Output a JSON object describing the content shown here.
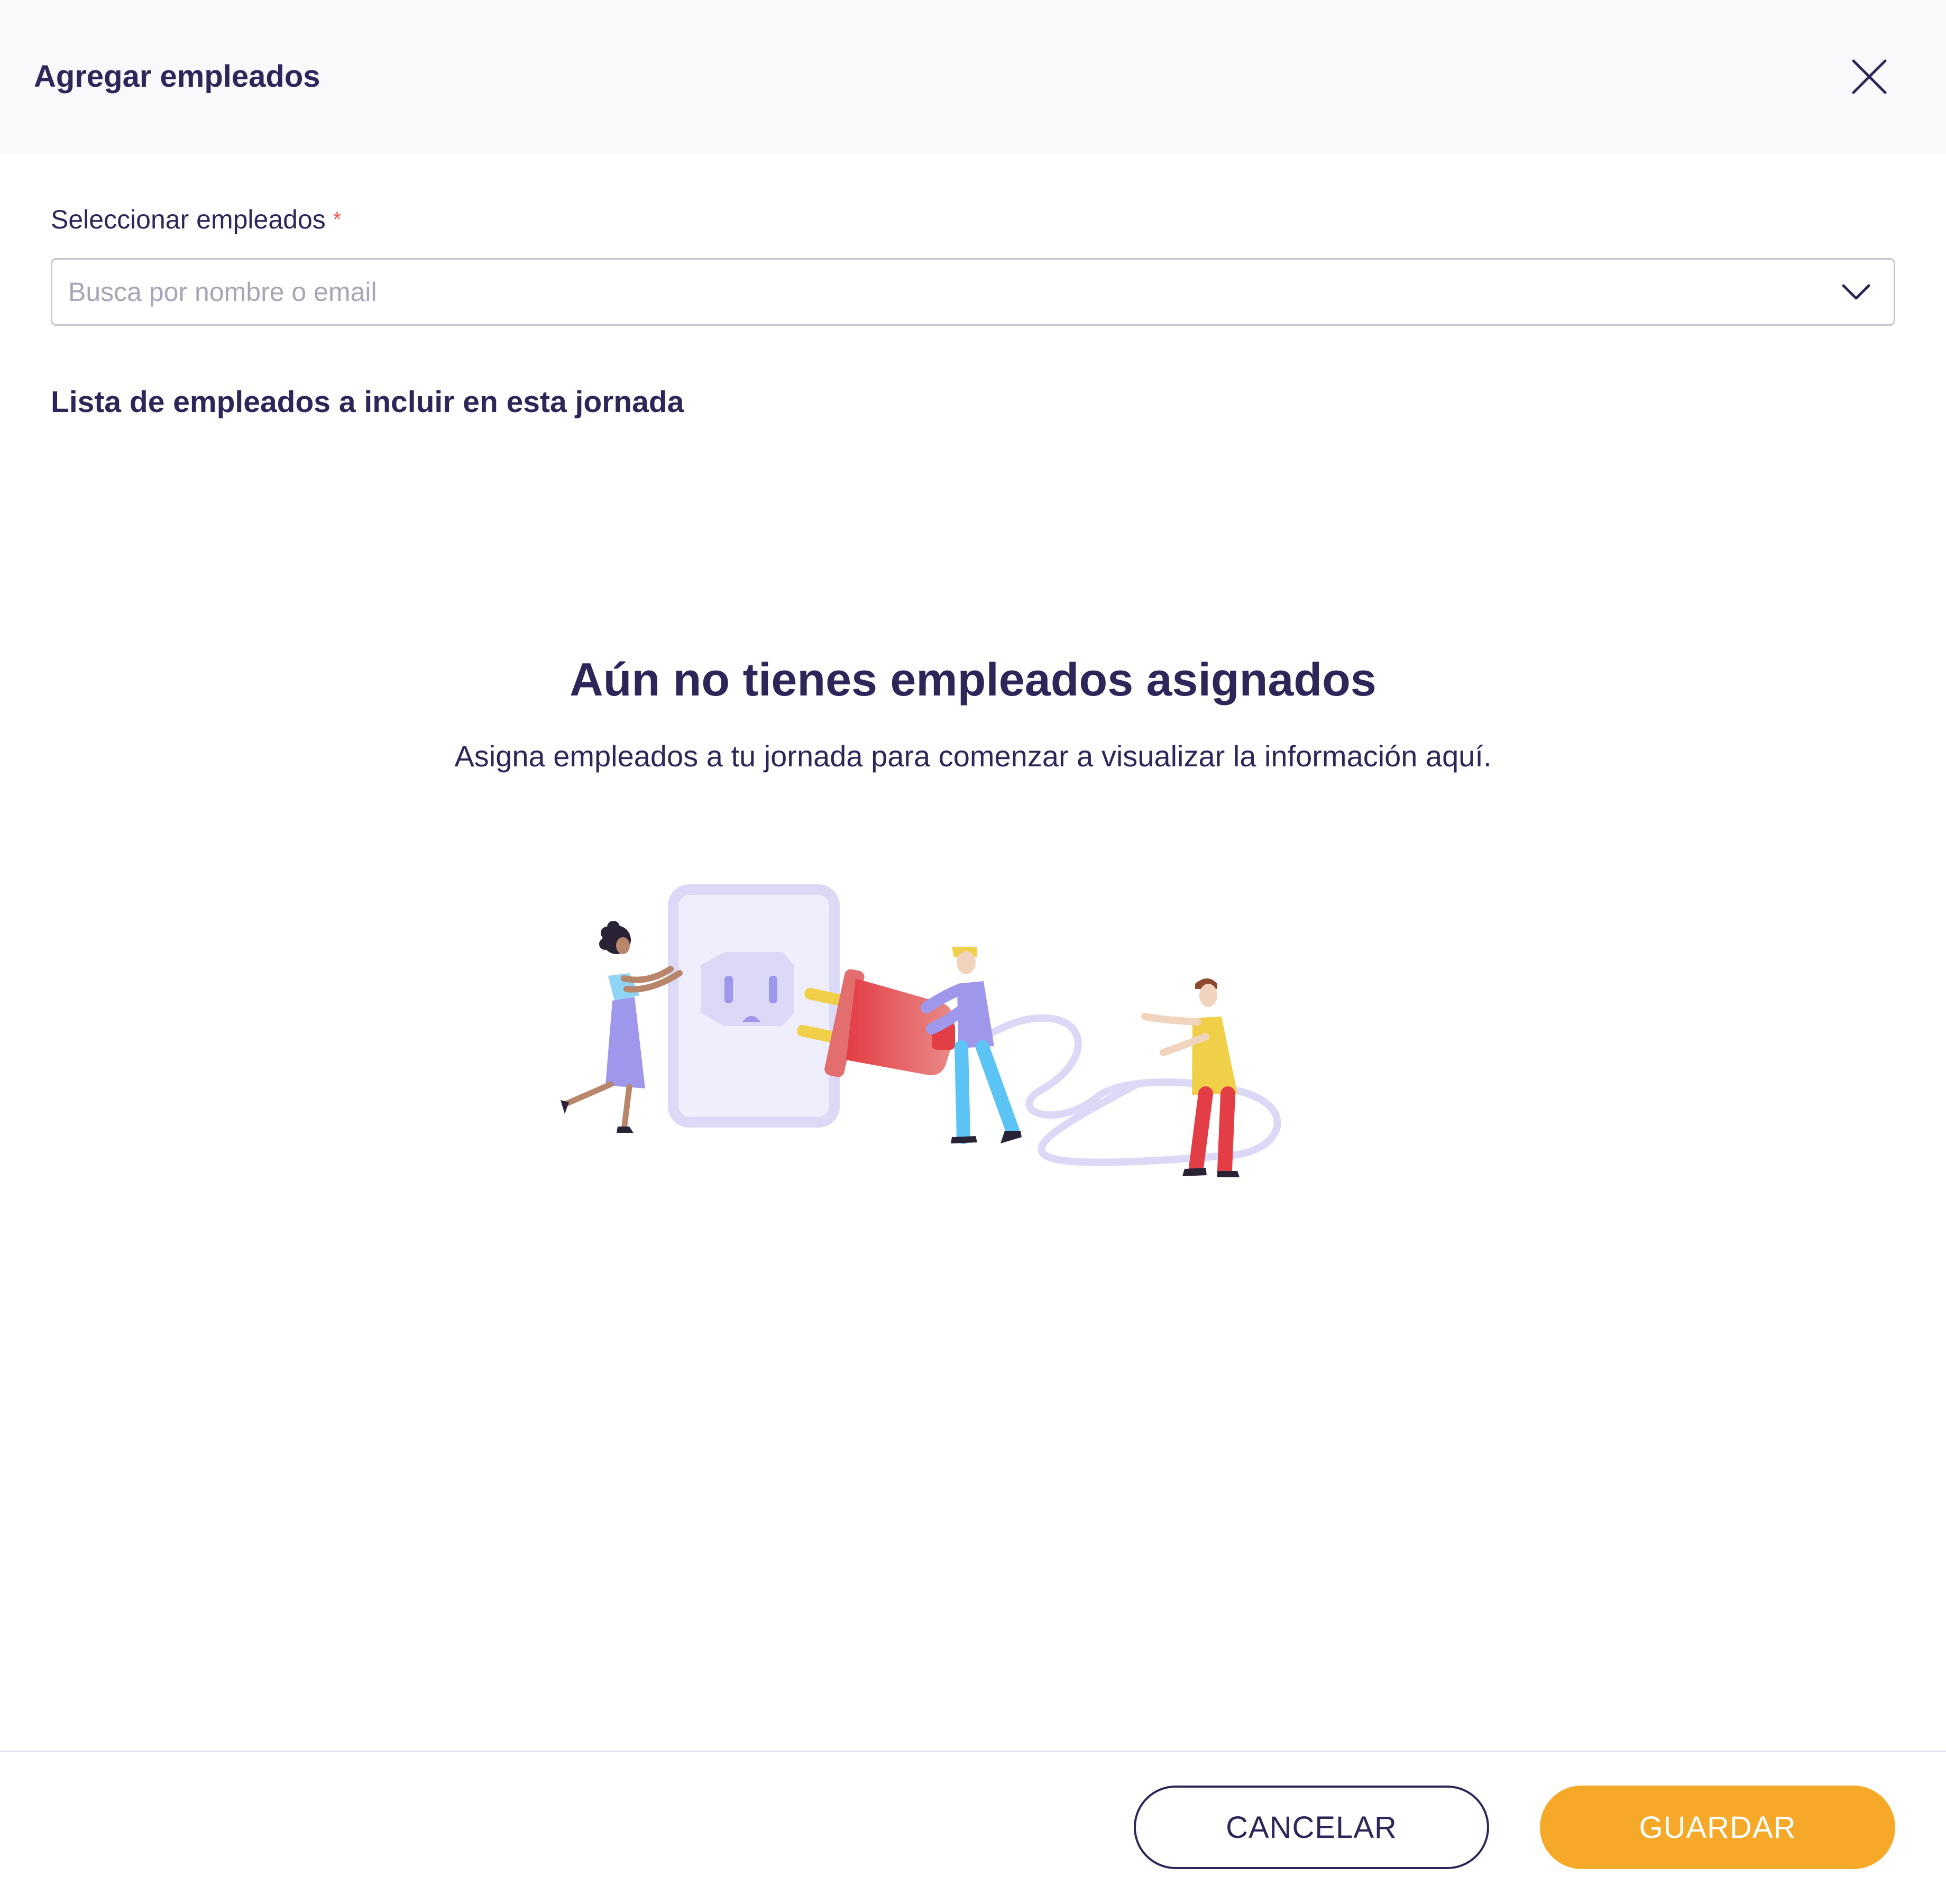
{
  "modal": {
    "title": "Agregar empleados"
  },
  "field": {
    "label": "Seleccionar empleados",
    "required_mark": "*",
    "placeholder": "Busca por nombre o email",
    "value": ""
  },
  "list": {
    "title": "Lista de empleados a incluir en esta jornada"
  },
  "empty_state": {
    "title": "Aún no tienes empleados asignados",
    "subtitle": "Asigna empleados a tu jornada para comenzar a visualizar la información aquí."
  },
  "footer": {
    "cancel_label": "CANCELAR",
    "save_label": "GUARDAR"
  },
  "colors": {
    "primary_text": "#2c2758",
    "accent": "#f6a829",
    "required": "#ea5a5a",
    "header_bg": "#f8f9fb",
    "border": "#c9c7d4"
  },
  "icons": {
    "close": "close-icon",
    "dropdown": "chevron-down-icon"
  }
}
